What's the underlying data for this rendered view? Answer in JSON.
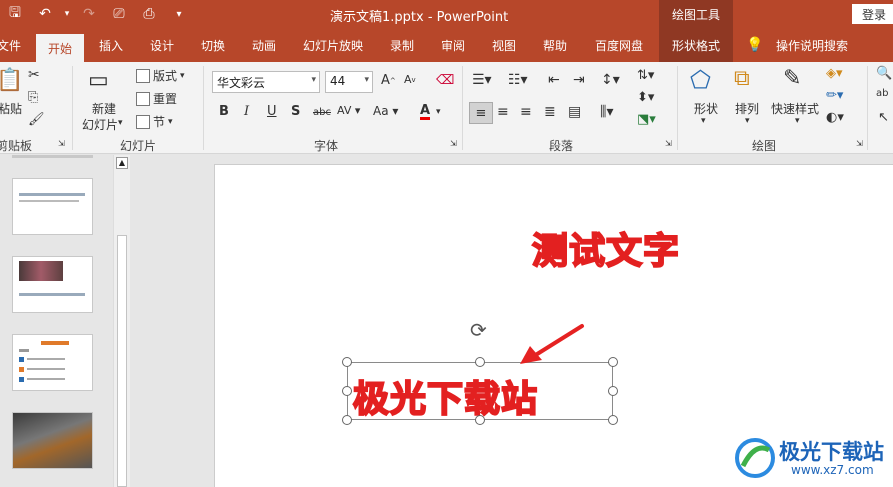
{
  "titlebar": {
    "doc_title": "演示文稿1.pptx  -  PowerPoint",
    "context_tools": "绘图工具",
    "login": "登录"
  },
  "tabs": [
    "文件",
    "开始",
    "插入",
    "设计",
    "切换",
    "动画",
    "幻灯片放映",
    "录制",
    "审阅",
    "视图",
    "帮助",
    "百度网盘",
    "形状格式",
    "操作说明搜索"
  ],
  "ribbon": {
    "clipboard": {
      "paste": "粘贴",
      "label": "剪贴板"
    },
    "slides": {
      "new_slide_line1": "新建",
      "new_slide_line2": "幻灯片",
      "layout": "版式",
      "reset": "重置",
      "section": "节",
      "label": "幻灯片"
    },
    "font": {
      "family": "华文彩云",
      "size": "44",
      "label": "字体"
    },
    "paragraph": {
      "label": "段落"
    },
    "drawing": {
      "shapes": "形状",
      "arrange": "排列",
      "quick_styles": "快速样式",
      "label": "绘图"
    }
  },
  "slide": {
    "text1": "测试文字",
    "text2": "极光下载站"
  },
  "watermark": {
    "name": "极光下载站",
    "url": "www.xz7.com"
  },
  "colors": {
    "accent": "#b7472a",
    "accent_dark": "#8f3823",
    "wordart_outline": "#e32020"
  }
}
